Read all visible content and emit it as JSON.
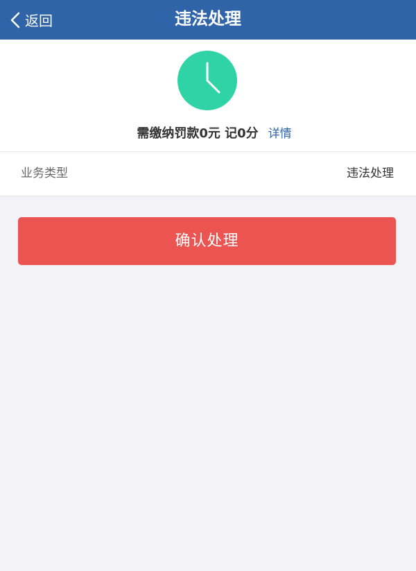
{
  "navbar": {
    "back_label": "返回",
    "title": "违法处理",
    "icons": {
      "back": "chevron-left-icon"
    },
    "background_color": "#2f64a8"
  },
  "summary": {
    "icon": "clock-icon",
    "icon_color": "#2fd3a6",
    "fine_text": "需缴纳罚款0元 记0分",
    "detail_link": "详情"
  },
  "business_row": {
    "label": "业务类型",
    "value": "违法处理"
  },
  "actions": {
    "confirm_label": "确认处理",
    "confirm_color": "#ec5452"
  }
}
